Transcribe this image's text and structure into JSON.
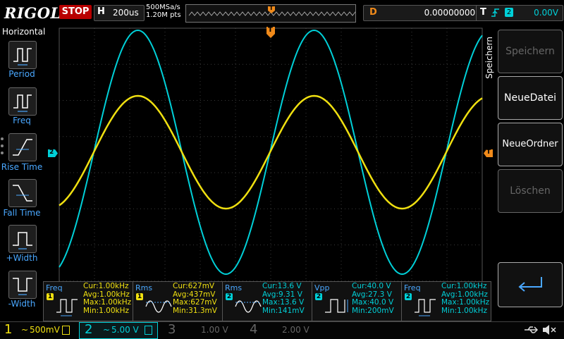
{
  "top": {
    "logo": "RIGOL",
    "status": "STOP",
    "timebase_key": "H",
    "timebase": "200us",
    "sample_rate": "500MSa/s",
    "mem_depth": "1.20M pts",
    "delay_key": "D",
    "delay": "0.00000000ps",
    "trigger_key": "T",
    "trigger_source": "2",
    "trigger_level": "0.00V"
  },
  "left_menu": {
    "title": "Horizontal",
    "items": [
      "Period",
      "Freq",
      "Rise Time",
      "Fall Time",
      "+Width",
      "-Width"
    ]
  },
  "right_menu": {
    "title": "Speichern",
    "buttons": [
      "Speichern",
      "NeueDatei",
      "NeueOrdner",
      "Löschen"
    ],
    "return_icon": "return-arrow-icon"
  },
  "markers": {
    "trigger_pos": "T",
    "ch2_offset": "2",
    "trig_level": "T"
  },
  "measurements": [
    {
      "name": "Freq",
      "channel": "1",
      "cur": "Cur:1.00kHz",
      "avg": "Avg:1.00kHz",
      "max": "Max:1.00kHz",
      "min": "Min:1.00kHz"
    },
    {
      "name": "Rms",
      "channel": "1",
      "cur": "Cur:627mV",
      "avg": "Avg:437mV",
      "max": "Max:627mV",
      "min": "Min:31.3mV"
    },
    {
      "name": "Rms",
      "channel": "2",
      "cur": "Cur:13.6 V",
      "avg": "Avg:9.31 V",
      "max": "Max:13.6 V",
      "min": "Min:141mV"
    },
    {
      "name": "Vpp",
      "channel": "2",
      "cur": "Cur:40.0 V",
      "avg": "Avg:27.3 V",
      "max": "Max:40.0 V",
      "min": "Min:200mV"
    },
    {
      "name": "Freq",
      "channel": "2",
      "cur": "Cur:1.00kHz",
      "avg": "Avg:1.00kHz",
      "max": "Max:1.00kHz",
      "min": "Min:1.00kHz"
    }
  ],
  "channels": [
    {
      "num": "1",
      "scale": "500mV",
      "coupling": "~",
      "color": "#f0e010"
    },
    {
      "num": "2",
      "scale": "5.00 V",
      "coupling": "~",
      "color": "#00d0d8"
    },
    {
      "num": "3",
      "scale": "1.00 V",
      "color": "#666666"
    },
    {
      "num": "4",
      "scale": "2.00 V",
      "color": "#666666"
    }
  ],
  "colors": {
    "ch1": "#f0e010",
    "ch2": "#00d0d8",
    "trigger": "#f08a1a",
    "menu_label": "#4aa8ff"
  }
}
